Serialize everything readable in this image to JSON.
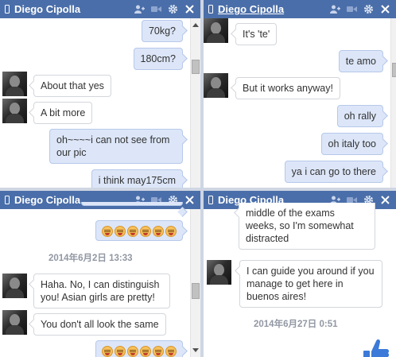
{
  "colors": {
    "header": "#4a6ea9",
    "outgoing_bubble": "#dce6f8",
    "incoming_bubble": "#ffffff",
    "like": "#3b7ad8"
  },
  "icons": [
    "mobile-icon",
    "add-friend-icon",
    "video-call-icon",
    "gear-icon",
    "close-icon",
    "thumbs-up-icon"
  ],
  "chats": [
    {
      "name": "Diego Cipolla",
      "messages": [
        "70kg?",
        "180cm?",
        "About that yes",
        "A bit more",
        "oh~~~~i can not see from our pic",
        "i think may175cm"
      ]
    },
    {
      "name": "Diego Cipolla",
      "messages": [
        "It's 'te'",
        "te amo",
        "But it works anyway!",
        "oh rally",
        "oh italy too",
        "ya i can go to there"
      ]
    },
    {
      "name": "Diego Cipolla",
      "timestamp": "2014年6月2日 13:33",
      "messages": [
        "Haha. No, I can distinguish you! Asian girls are pretty!",
        "You don't all look the same"
      ]
    },
    {
      "name": "Diego Cipolla",
      "timestamp": "2014年6月27日 0:51",
      "messages": [
        "middle of the exams weeks, so I'm somewhat distracted",
        "I can guide you around if you manage to get here in buenos aires!"
      ]
    }
  ]
}
